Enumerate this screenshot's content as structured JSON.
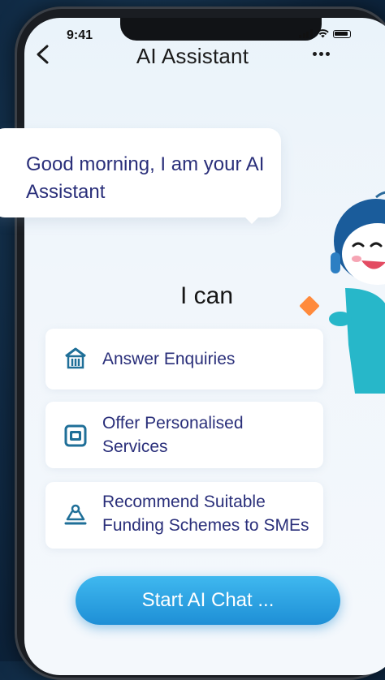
{
  "status_bar": {
    "time": "9:41"
  },
  "nav": {
    "title": "AI Assistant"
  },
  "greeting": {
    "text": "Good morning, I am your AI Assistant"
  },
  "capabilities": {
    "heading": "I can",
    "items": [
      {
        "label": "Answer Enquiries",
        "icon": "building-icon"
      },
      {
        "label": "Offer Personalised Services",
        "icon": "service-icon"
      },
      {
        "label": "Recommend Suitable Funding Schemes to SMEs",
        "icon": "funding-icon"
      }
    ]
  },
  "cta": {
    "label": "Start AI Chat ..."
  },
  "colors": {
    "accent": "#1e8fd6",
    "text_primary": "#2a2f7a",
    "highlight": "#ff8a3c"
  }
}
